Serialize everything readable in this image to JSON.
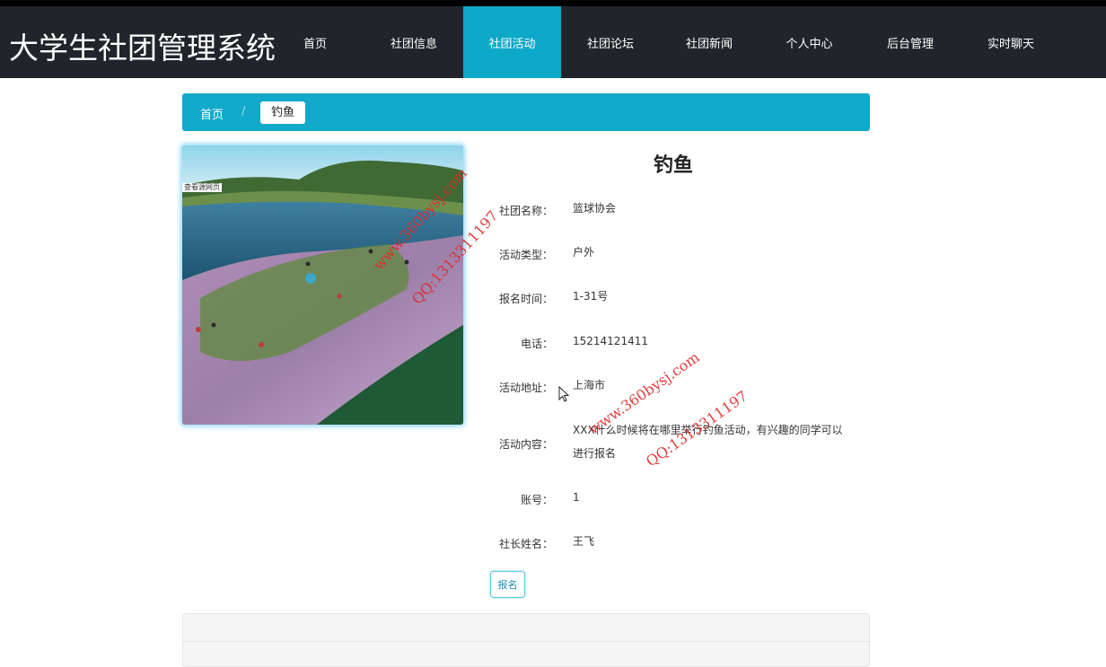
{
  "brand": "大学生社团管理系统",
  "nav": [
    {
      "label": "首页",
      "active": false
    },
    {
      "label": "社团信息",
      "active": false
    },
    {
      "label": "社团活动",
      "active": true
    },
    {
      "label": "社团论坛",
      "active": false
    },
    {
      "label": "社团新闻",
      "active": false
    },
    {
      "label": "个人中心",
      "active": false
    },
    {
      "label": "后台管理",
      "active": false
    },
    {
      "label": "实时聊天",
      "active": false
    }
  ],
  "breadcrumb": {
    "home": "首页",
    "separator": "/",
    "current": "钓鱼"
  },
  "photo_tag": "查看源网页",
  "detail": {
    "title": "钓鱼",
    "rows": [
      {
        "label": "社团名称：",
        "value": "篮球协会"
      },
      {
        "label": "活动类型：",
        "value": "户外"
      },
      {
        "label": "报名时间：",
        "value": "1-31号"
      },
      {
        "label": "电话：",
        "value": "15214121411"
      },
      {
        "label": "活动地址：",
        "value": "上海市"
      },
      {
        "label": "活动内容：",
        "value": "XXX什么时候将在哪里举行钓鱼活动，有兴趣的同学可以进行报名"
      },
      {
        "label": "账号：",
        "value": "1"
      },
      {
        "label": "社长姓名：",
        "value": "王飞"
      }
    ],
    "signup_label": "报名"
  },
  "watermarks": {
    "site": "www.360bysj.com",
    "qq": "QQ:1313311197"
  },
  "colors": {
    "navbar": "#21252b",
    "accent": "#0ea8c9",
    "breadcrumb": "#13a9cb",
    "watermark": "#e02a2a"
  }
}
